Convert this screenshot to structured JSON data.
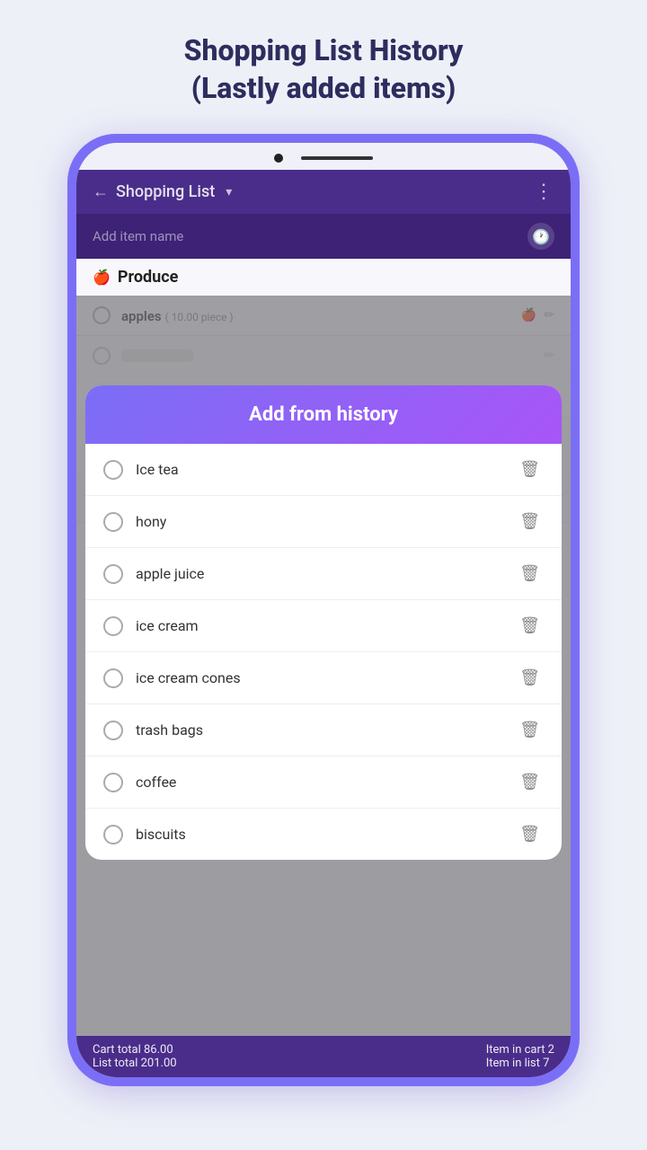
{
  "page": {
    "title_line1": "Shopping List History",
    "title_line2": "(Lastly added items)"
  },
  "app": {
    "header": {
      "back_label": "←",
      "title": "Shopping List",
      "dropdown_arrow": "▾",
      "menu_dots": "⋮"
    },
    "add_item_placeholder": "Add item name",
    "section": {
      "icon": "🍎",
      "title": "Produce"
    },
    "bg_items": [
      {
        "name": "apples",
        "detail": "( 10.00 piece )",
        "emoji": "🍎"
      },
      {
        "name": "",
        "detail": ""
      },
      {
        "name": "",
        "detail": ""
      }
    ],
    "bottom_bar": {
      "cart_total_label": "Cart total 86.00",
      "list_total_label": "List total 201.00",
      "item_in_cart_label": "Item in cart 2",
      "item_in_list_label": "Item in list 7"
    }
  },
  "modal": {
    "title": "Add from history",
    "items": [
      {
        "id": "ice-tea",
        "label": "Ice tea"
      },
      {
        "id": "hony",
        "label": "hony"
      },
      {
        "id": "apple-juice",
        "label": "apple juice"
      },
      {
        "id": "ice-cream",
        "label": "ice cream"
      },
      {
        "id": "ice-cream-cones",
        "label": "ice cream cones"
      },
      {
        "id": "trash-bags",
        "label": "trash bags"
      },
      {
        "id": "coffee",
        "label": "coffee"
      },
      {
        "id": "biscuits",
        "label": "biscuits"
      }
    ]
  },
  "icons": {
    "back": "←",
    "delete": "🗑",
    "clock": "🕐",
    "check": "✓",
    "pencil": "✏"
  }
}
